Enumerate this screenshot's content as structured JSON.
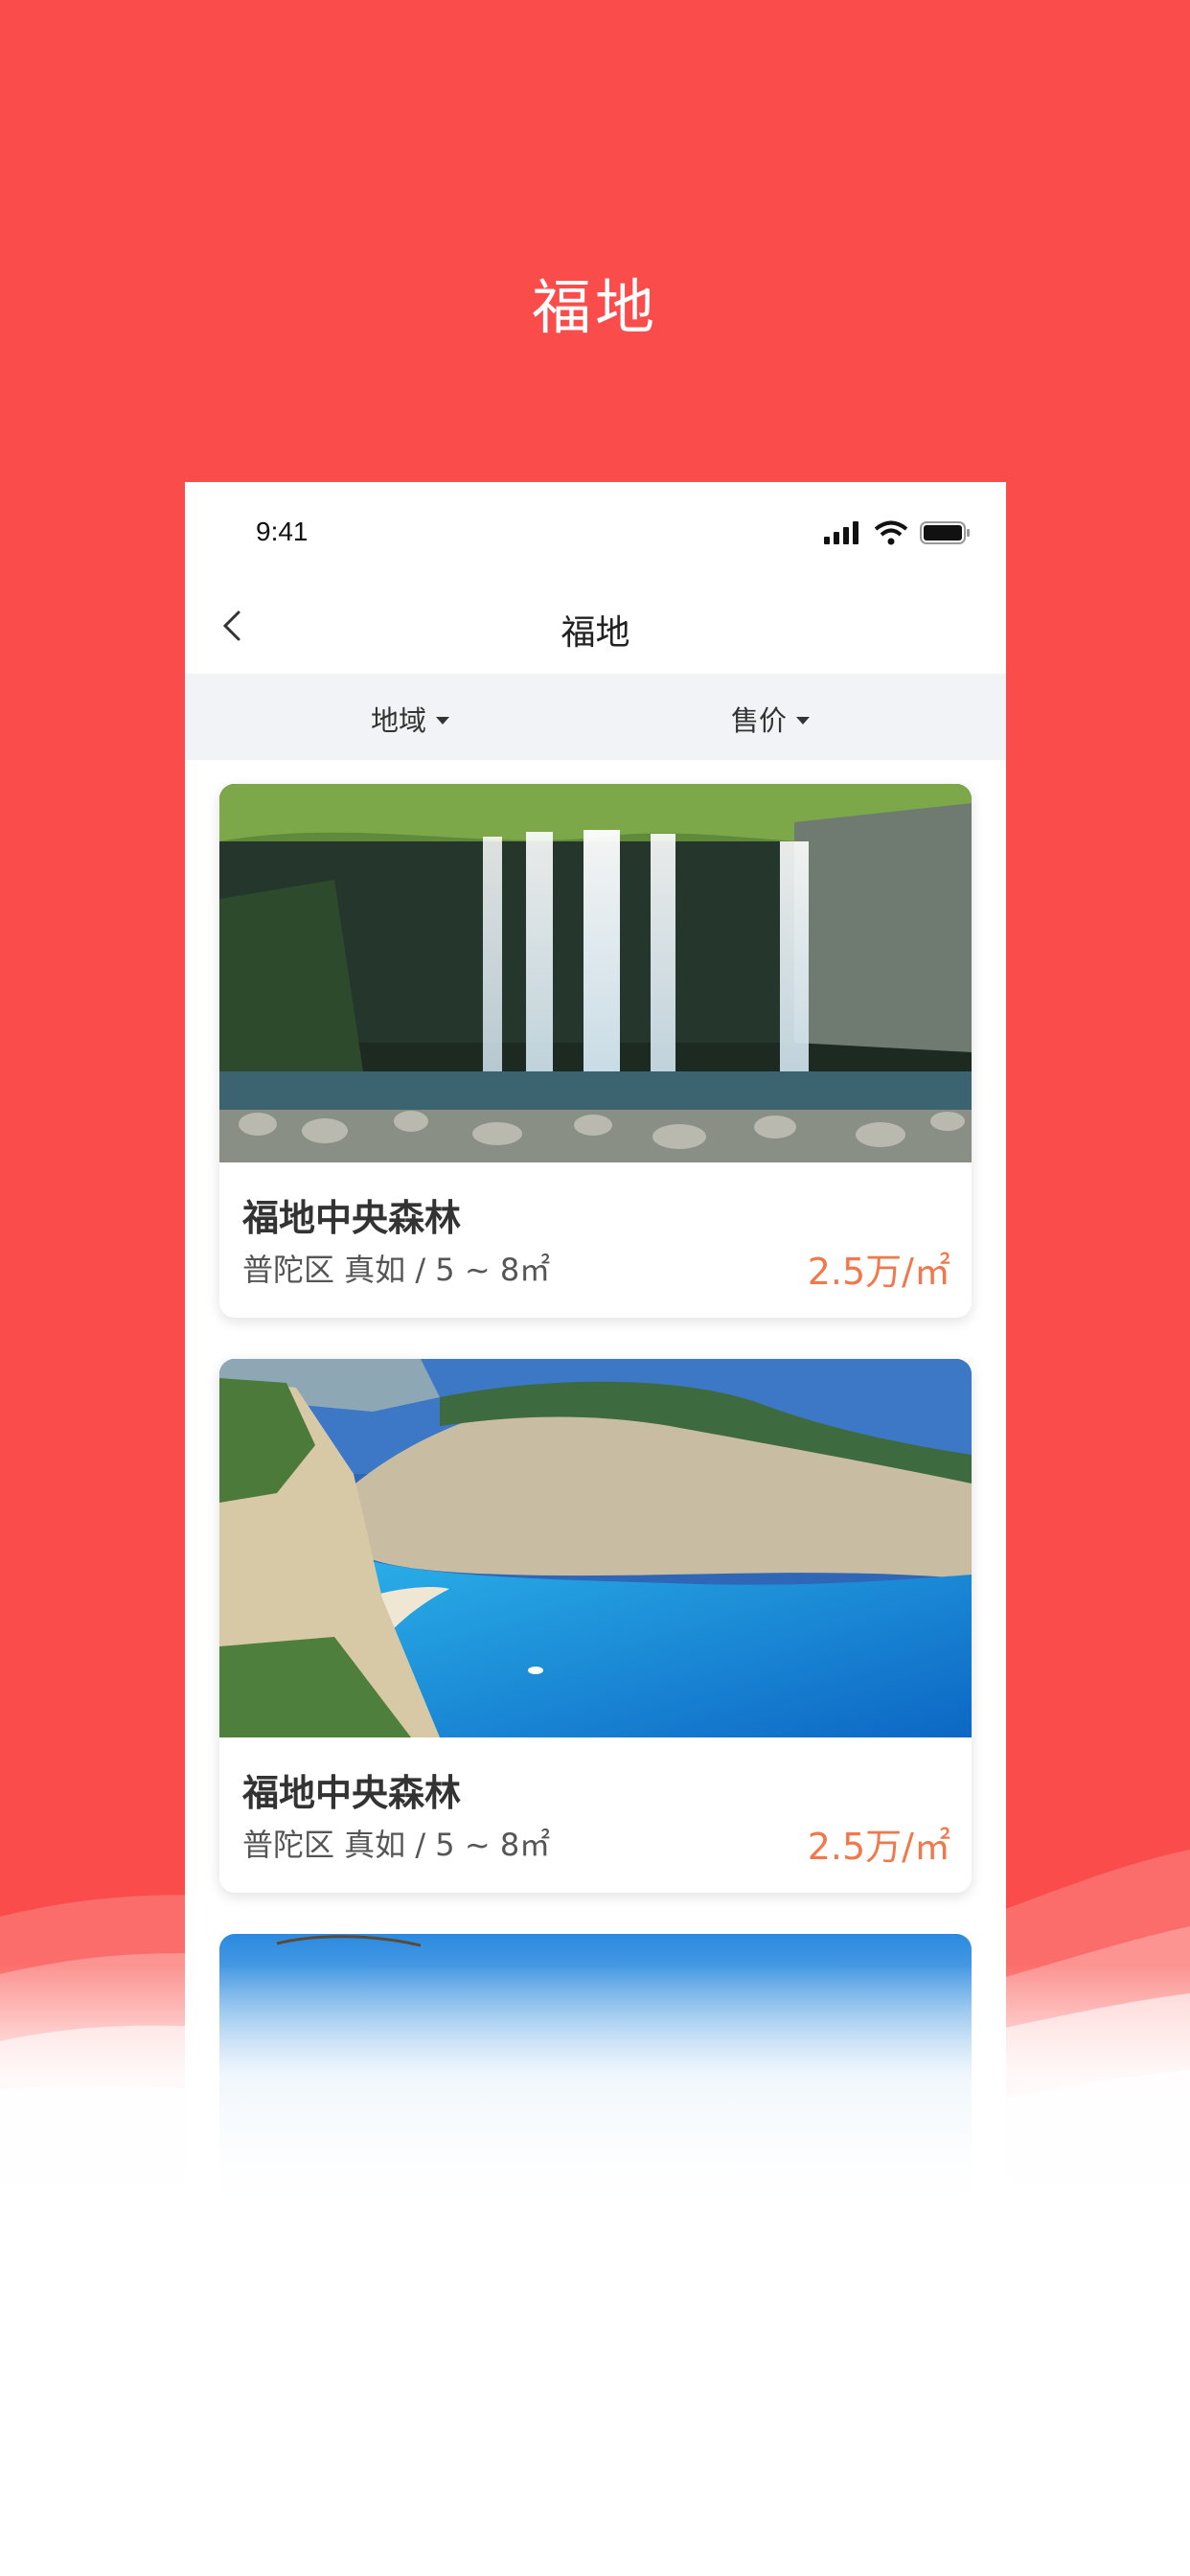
{
  "headline": "福地",
  "status_bar": {
    "time": "9:41"
  },
  "nav": {
    "title": "福地"
  },
  "filters": [
    {
      "label": "地域"
    },
    {
      "label": "售价"
    }
  ],
  "listings": [
    {
      "title": "福地中央森林",
      "meta": "普陀区 真如 / 5 ~ 8㎡",
      "price": "2.5万/㎡",
      "image": "waterfall-forest"
    },
    {
      "title": "福地中央森林",
      "meta": "普陀区 真如 / 5 ~ 8㎡",
      "price": "2.5万/㎡",
      "image": "beach-cove"
    },
    {
      "title": "",
      "meta": "",
      "price": "",
      "image": "sky"
    }
  ],
  "colors": {
    "background": "#fa4d4b",
    "price": "#f2784b",
    "filter_bar": "#f2f3f6"
  },
  "icons": [
    "back-chevron-icon",
    "cellular-signal-icon",
    "wifi-icon",
    "battery-icon",
    "dropdown-caret-icon"
  ]
}
